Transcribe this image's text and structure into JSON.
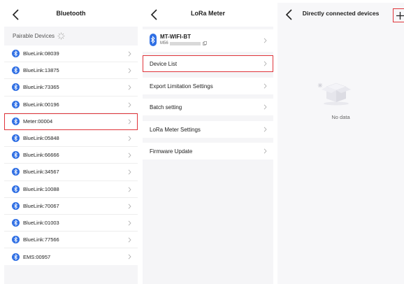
{
  "bluetooth_screen": {
    "title": "Bluetooth",
    "section_label": "Pairable Devices",
    "devices": [
      {
        "label": "BlueLink:08039"
      },
      {
        "label": "BlueLink:13875"
      },
      {
        "label": "BlueLink:73365"
      },
      {
        "label": "BlueLink:00196"
      },
      {
        "label": "Meter:00004",
        "highlighted": true
      },
      {
        "label": "BlueLink:05848"
      },
      {
        "label": "BlueLink:66666"
      },
      {
        "label": "BlueLink:34567"
      },
      {
        "label": "BlueLink:10088"
      },
      {
        "label": "BlueLink:70067"
      },
      {
        "label": "BlueLink:01003"
      },
      {
        "label": "BlueLink:77566"
      },
      {
        "label": "EMS:00957"
      }
    ]
  },
  "lora_screen": {
    "title": "LoRa Meter",
    "device_name": "MT-WIFI-BT",
    "device_sn_prefix": "M56",
    "menu": [
      {
        "label": "Device List",
        "highlighted": true
      },
      {
        "label": "Export Limitation Settings"
      },
      {
        "label": "Batch setting"
      },
      {
        "label": "LoRa Meter Settings"
      },
      {
        "label": "Firmware Update"
      }
    ]
  },
  "direct_screen": {
    "title": "Directly connected devices",
    "empty_text": "No data"
  },
  "icons": {
    "back": "chevron-left-icon",
    "chevron": "chevron-right-icon",
    "bluetooth": "bluetooth-icon",
    "loading": "spinner-icon",
    "copy": "copy-icon",
    "add": "plus-icon",
    "empty": "empty-box-icon"
  },
  "colors": {
    "bluetooth": "#2f6fe4",
    "highlight": "#e0343a",
    "background": "#f5f5f7"
  }
}
